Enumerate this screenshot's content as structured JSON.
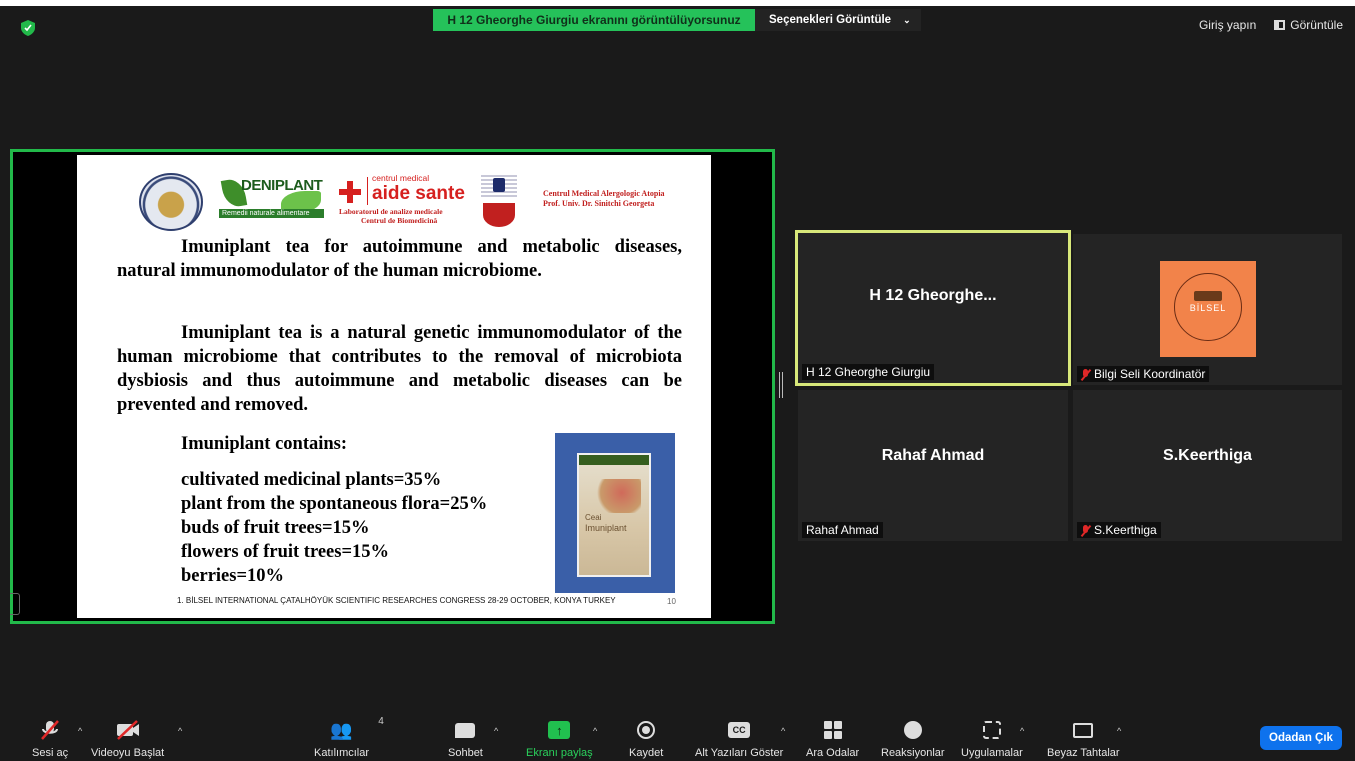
{
  "banner": {
    "sharing": "H 12 Gheorghe Giurgiu ekranını görüntülüyorsunuz",
    "options": "Seçenekleri Görüntüle"
  },
  "topright": {
    "signin": "Giriş yapın",
    "view": "Görüntüle"
  },
  "slide": {
    "logos": {
      "deniplant": "DENIPLANT",
      "deniplant_sub": "Remedii naturale alimentare",
      "aide_small": "centrul medical",
      "aide_big": "aide sante",
      "aide_lab": "Laboratorul de analize medicale",
      "aide_bio": "Centrul de Biomedicină",
      "atopia_1": "Centrul Medical Alergologic Atopia",
      "atopia_2": "Prof. Univ. Dr. Sinitchi Georgeta"
    },
    "para1": "Imuniplant tea for autoimmune and metabolic diseases, natural immunomodulator of the human microbiome.",
    "para2": "Imuniplant tea is a natural genetic immunomodulator of the human microbiome that contributes to the removal of microbiota dysbiosis and thus autoimmune and metabolic diseases can be prevented and removed.",
    "contains": "Imuniplant contains:",
    "items": [
      "cultivated medicinal plants=35%",
      "plant from the spontaneous flora=25%",
      "buds of fruit trees=15%",
      "flowers of fruit trees=15%",
      "berries=10%"
    ],
    "package_t1": "Ceai",
    "package_t2": "Imuniplant",
    "footer": "1. BİLSEL INTERNATIONAL ÇATALHÖYÜK SCIENTIFIC RESEARCHES CONGRESS 28-29 OCTOBER, KONYA TURKEY",
    "page": "10"
  },
  "participants": [
    {
      "display": "H 12 Gheorghe...",
      "label": "H 12 Gheorghe Giurgiu",
      "muted": false
    },
    {
      "display": "",
      "label": "Bilgi Seli Koordinatör",
      "muted": true,
      "avatar_text": "BİLSEL"
    },
    {
      "display": "Rahaf Ahmad",
      "label": "Rahaf Ahmad",
      "muted": false
    },
    {
      "display": "S.Keerthiga",
      "label": "S.Keerthiga",
      "muted": true
    }
  ],
  "toolbar": {
    "audio": "Sesi aç",
    "video": "Videoyu Başlat",
    "participants": "Katılımcılar",
    "participants_count": "4",
    "chat": "Sohbet",
    "share": "Ekranı paylaş",
    "record": "Kaydet",
    "captions": "Alt Yazıları Göster",
    "breakout": "Ara Odalar",
    "reactions": "Reaksiyonlar",
    "apps": "Uygulamalar",
    "whiteboard": "Beyaz Tahtalar",
    "leave": "Odadan Çık",
    "cc": "CC"
  }
}
